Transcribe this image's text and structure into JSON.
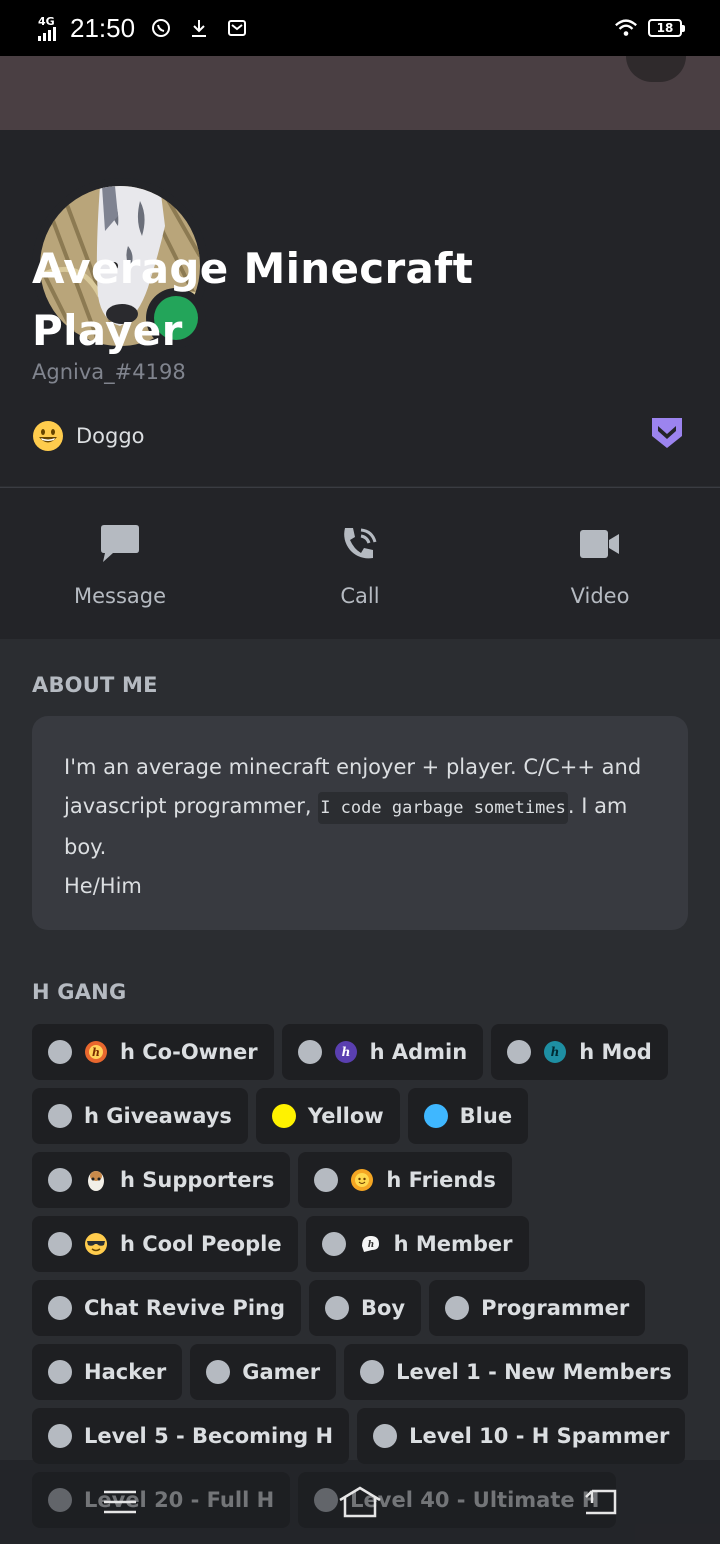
{
  "status_bar": {
    "network": "4G",
    "time": "21:50",
    "battery": "18"
  },
  "profile": {
    "display_name": "Average Minecraft Player",
    "username": "Agniva_#4198",
    "custom_status": "Doggo",
    "online_color": "#23a55a",
    "badge_icon": "hypesquad-badge-icon"
  },
  "actions": [
    {
      "label": "Message",
      "icon": "message-icon"
    },
    {
      "label": "Call",
      "icon": "call-icon"
    },
    {
      "label": "Video",
      "icon": "video-icon"
    }
  ],
  "about": {
    "title": "ABOUT ME",
    "text_before": "I'm an average minecraft enjoyer + player. C/C++ and javascript programmer, ",
    "code": "I code garbage sometimes",
    "text_after": ". I am boy.",
    "line2": "He/Him"
  },
  "roles_section": {
    "title": "H GANG",
    "roles": [
      {
        "name": "h Co-Owner",
        "color": "#b5bac1",
        "emoji": "fire-h-emoji"
      },
      {
        "name": "h Admin",
        "color": "#b5bac1",
        "emoji": "purple-h-emoji"
      },
      {
        "name": "h Mod",
        "color": "#b5bac1",
        "emoji": "teal-h-emoji"
      },
      {
        "name": "h Giveaways",
        "color": "#b5bac1"
      },
      {
        "name": "Yellow",
        "color": "#fff200"
      },
      {
        "name": "Blue",
        "color": "#3fb7ff"
      },
      {
        "name": "h Supporters",
        "color": "#b5bac1",
        "emoji": "hamster-emoji"
      },
      {
        "name": "h Friends",
        "color": "#b5bac1",
        "emoji": "sun-face-emoji"
      },
      {
        "name": "h Cool People",
        "color": "#b5bac1",
        "emoji": "sunglasses-emoji"
      },
      {
        "name": "h Member",
        "color": "#b5bac1",
        "emoji": "ghost-h-emoji"
      },
      {
        "name": "Chat Revive Ping",
        "color": "#b5bac1"
      },
      {
        "name": "Boy",
        "color": "#b5bac1"
      },
      {
        "name": "Programmer",
        "color": "#b5bac1"
      },
      {
        "name": "Hacker",
        "color": "#b5bac1"
      },
      {
        "name": "Gamer",
        "color": "#b5bac1"
      },
      {
        "name": "Level 1 - New Members",
        "color": "#b5bac1"
      },
      {
        "name": "Level 5 - Becoming H",
        "color": "#b5bac1"
      },
      {
        "name": "Level 10 - H Spammer",
        "color": "#b5bac1"
      },
      {
        "name": "Level 20 - Full H",
        "color": "#b5bac1"
      },
      {
        "name": "Level 40 - Ultimate H",
        "color": "#b5bac1"
      }
    ]
  }
}
